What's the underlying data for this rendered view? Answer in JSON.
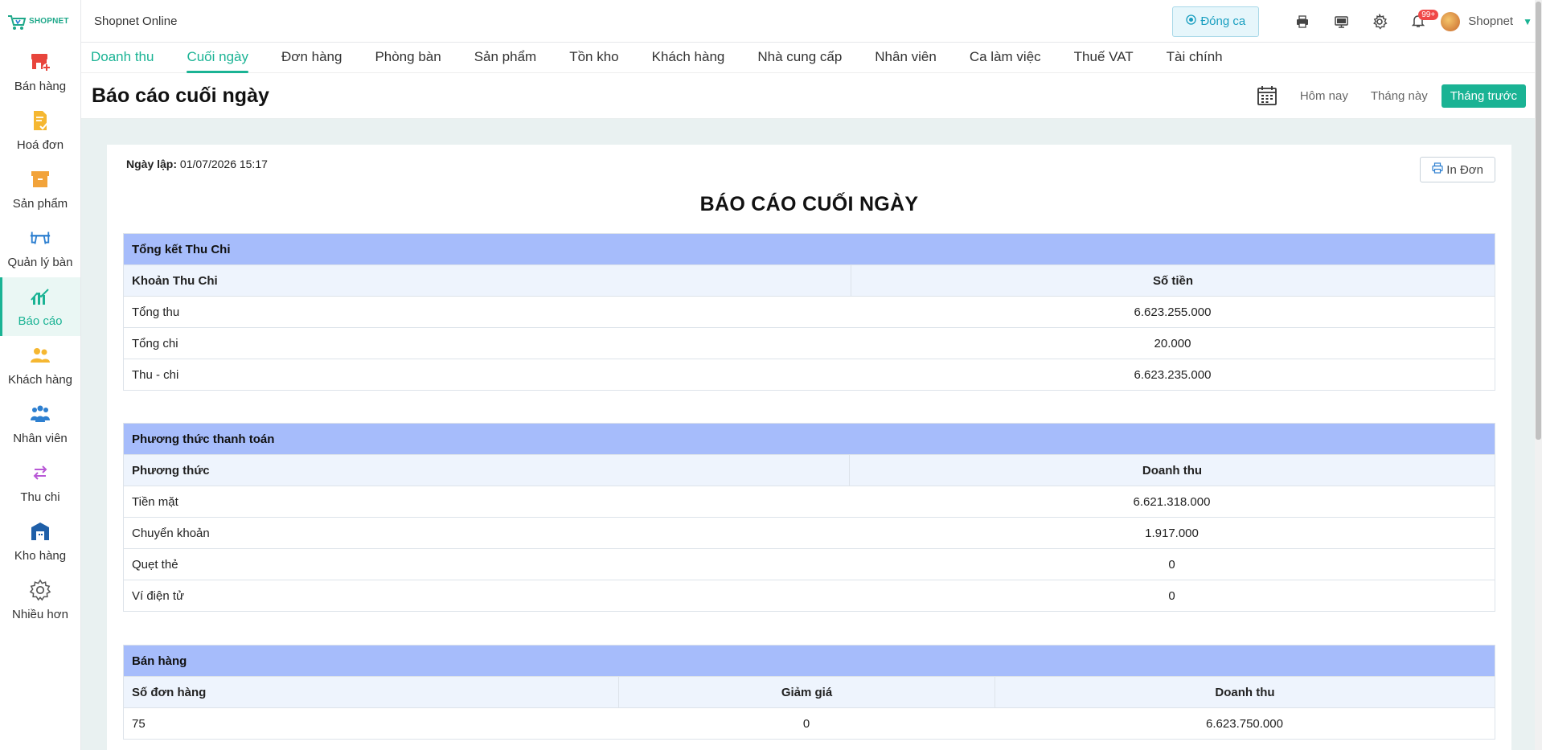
{
  "logo": {
    "text": "SHOPNET"
  },
  "sidebar": {
    "items": [
      {
        "label": "Bán hàng",
        "icon": "store-add-icon"
      },
      {
        "label": "Hoá đơn",
        "icon": "invoice-icon"
      },
      {
        "label": "Sản phẩm",
        "icon": "box-icon"
      },
      {
        "label": "Quản lý bàn",
        "icon": "table-icon"
      },
      {
        "label": "Báo cáo",
        "icon": "chart-icon",
        "active": true
      },
      {
        "label": "Khách hàng",
        "icon": "customers-icon"
      },
      {
        "label": "Nhân viên",
        "icon": "staff-icon"
      },
      {
        "label": "Thu chi",
        "icon": "exchange-icon"
      },
      {
        "label": "Kho hàng",
        "icon": "warehouse-icon"
      },
      {
        "label": "Nhiều hơn",
        "icon": "gear-icon"
      }
    ]
  },
  "topbar": {
    "store_name": "Shopnet Online",
    "shift_button": "Đóng ca",
    "notification_count": "99+",
    "user_name": "Shopnet"
  },
  "tabs": [
    {
      "label": "Doanh thu"
    },
    {
      "label": "Cuối ngày",
      "active": true
    },
    {
      "label": "Đơn hàng"
    },
    {
      "label": "Phòng bàn"
    },
    {
      "label": "Sản phẩm"
    },
    {
      "label": "Tồn kho"
    },
    {
      "label": "Khách hàng"
    },
    {
      "label": "Nhà cung cấp"
    },
    {
      "label": "Nhân viên"
    },
    {
      "label": "Ca làm việc"
    },
    {
      "label": "Thuế VAT"
    },
    {
      "label": "Tài chính"
    }
  ],
  "header": {
    "title": "Báo cáo cuối ngày",
    "filters": {
      "today": "Hôm nay",
      "this_month": "Tháng này",
      "last_month": "Tháng trước"
    }
  },
  "report": {
    "created_label": "Ngày lập:",
    "created_value": "01/07/2026 15:17",
    "print_button": "In Đơn",
    "title": "BÁO CÁO CUỐI NGÀY",
    "summary": {
      "heading": "Tổng kết Thu Chi",
      "col1": "Khoản Thu Chi",
      "col2": "Số tiền",
      "rows": [
        {
          "name": "Tổng thu",
          "value": "6.623.255.000"
        },
        {
          "name": "Tổng chi",
          "value": "20.000"
        },
        {
          "name": "Thu - chi",
          "value": "6.623.235.000"
        }
      ]
    },
    "payments": {
      "heading": "Phương thức thanh toán",
      "col1": "Phương thức",
      "col2": "Doanh thu",
      "rows": [
        {
          "name": "Tiền mặt",
          "value": "6.621.318.000"
        },
        {
          "name": "Chuyển khoản",
          "value": "1.917.000"
        },
        {
          "name": "Quẹt thẻ",
          "value": "0"
        },
        {
          "name": "Ví điện tử",
          "value": "0"
        }
      ]
    },
    "sales": {
      "heading": "Bán hàng",
      "col1": "Số đơn hàng",
      "col2": "Giảm giá",
      "col3": "Doanh thu",
      "orders": "75",
      "discount": "0",
      "revenue": "6.623.750.000"
    }
  },
  "colors": {
    "accent": "#1ab394",
    "section_header": "#a6bcfb",
    "column_header": "#eef4fd",
    "background": "#e9f1f1"
  }
}
